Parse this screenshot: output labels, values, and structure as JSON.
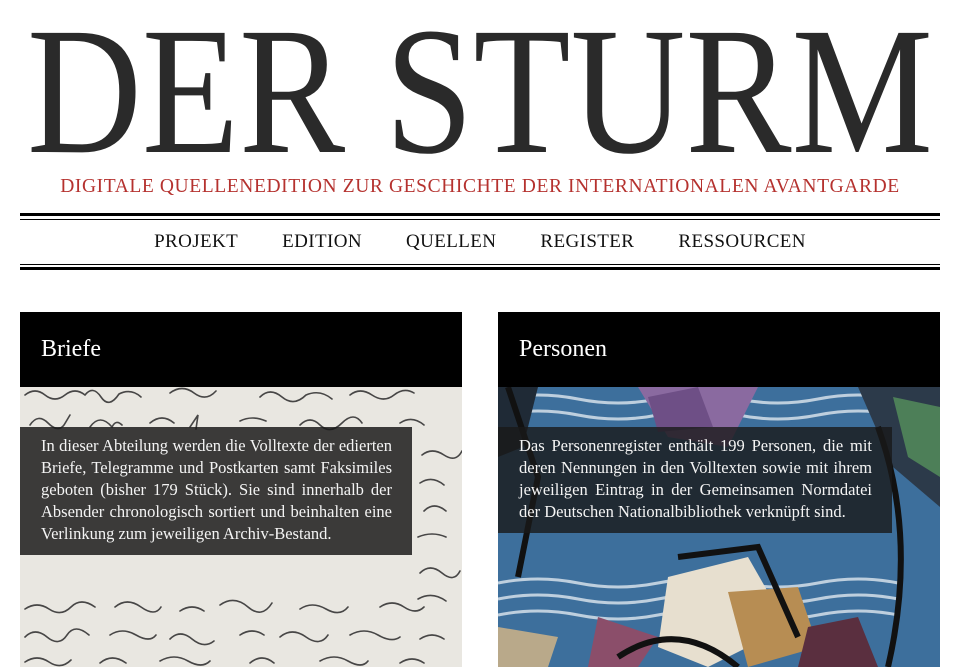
{
  "site": {
    "title": "DER STURM",
    "subtitle": "DIGITALE QUELLENEDITION ZUR GESCHICHTE DER INTERNATIONALEN AVANTGARDE"
  },
  "nav": {
    "items": [
      {
        "label": "PROJEKT"
      },
      {
        "label": "EDITION"
      },
      {
        "label": "QUELLEN"
      },
      {
        "label": "REGISTER"
      },
      {
        "label": "RESSOURCEN"
      }
    ]
  },
  "cards": [
    {
      "title": "Briefe",
      "text": "In dieser Abteilung werden die Volltexte der edierten Briefe, Telegramme und Postkarten samt Faksimiles geboten (bisher 179 Stück). Sie sind innerhalb der Absender chronologisch sortiert und beinhalten eine Verlinkung zum jeweiligen Archiv-Bestand.",
      "image": "handwritten-letter-image"
    },
    {
      "title": "Personen",
      "text": "Das Personenregister enthält 199 Personen, die mit deren Nennungen in den Volltexten sowie mit ihrem jeweiligen Eintrag in der Gemeinsamen Normdatei der Deutschen Nationalbibliothek verknüpft sind.",
      "image": "expressionist-painting-image"
    }
  ],
  "colors": {
    "accent": "#b5322f",
    "header_bg": "#000000",
    "text": "#111111"
  }
}
